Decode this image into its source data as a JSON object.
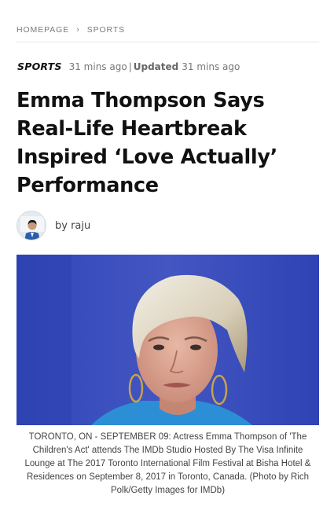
{
  "breadcrumb": {
    "home": "HOMEPAGE",
    "separator": "›",
    "section": "SPORTS"
  },
  "meta": {
    "category": "SPORTS",
    "published": "31 mins ago",
    "pipe": "|",
    "updated_label": "Updated",
    "updated": "31 mins ago"
  },
  "article": {
    "title": "Emma Thompson Says Real-Life Heartbreak Inspired ‘Love Actually’ Performance",
    "author": "by raju",
    "caption": "TORONTO, ON - SEPTEMBER 09: Actress Emma Thompson of 'The Children's Act' attends The IMDb Studio Hosted By The Visa Infinite Lounge at The 2017 Toronto International Film Festival at Bisha Hotel & Residences on September 8, 2017 in Toronto, Canada. (Photo by Rich Polk/Getty Images for IMDb)"
  },
  "colors": {
    "photo_background": "#3d4fbe",
    "text": "#111111",
    "muted": "#7a7a7a"
  }
}
